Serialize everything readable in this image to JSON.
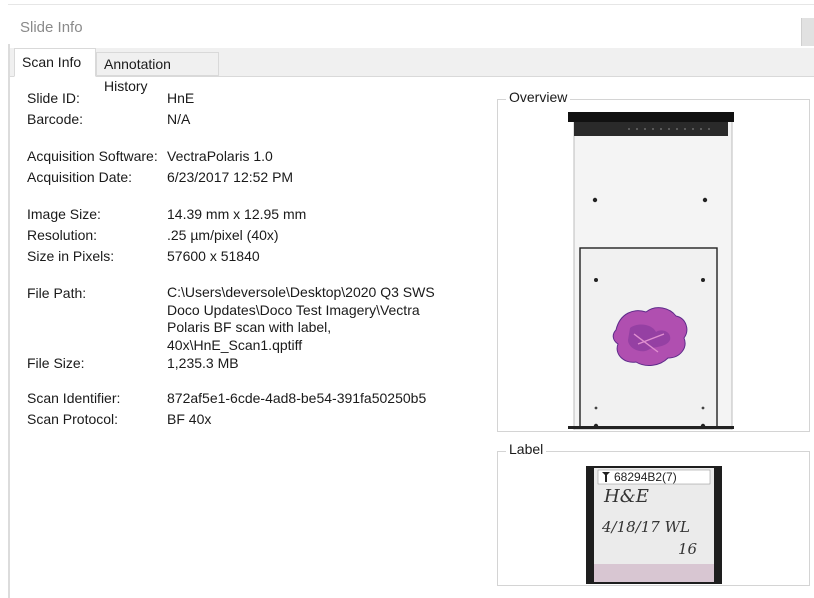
{
  "window": {
    "title": "Slide Info"
  },
  "tabs": [
    {
      "label": "Scan Info",
      "active": true
    },
    {
      "label": "Annotation History",
      "active": false
    }
  ],
  "scan_info": {
    "slide_id": {
      "key": "Slide ID:",
      "value": "HnE"
    },
    "barcode": {
      "key": "Barcode:",
      "value": "N/A"
    },
    "acq_software": {
      "key": "Acquisition Software:",
      "value": "VectraPolaris 1.0"
    },
    "acq_date": {
      "key": "Acquisition Date:",
      "value": "6/23/2017 12:52 PM"
    },
    "image_size": {
      "key": "Image Size:",
      "value": "14.39 mm x 12.95 mm"
    },
    "resolution": {
      "key": "Resolution:",
      "value": ".25 µm/pixel (40x)"
    },
    "size_pixels": {
      "key": "Size in Pixels:",
      "value": "57600 x 51840"
    },
    "file_path": {
      "key": "File Path:",
      "value": "C:\\Users\\deversole\\Desktop\\2020 Q3 SWS\nDoco Updates\\Doco Test Imagery\\Vectra\nPolaris BF scan with label,\n40x\\HnE_Scan1.qptiff"
    },
    "file_size": {
      "key": "File Size:",
      "value": "1,235.3 MB"
    },
    "scan_identifier": {
      "key": "Scan Identifier:",
      "value": "872af5e1-6cde-4ad8-be54-391fa50250b5"
    },
    "scan_protocol": {
      "key": "Scan Protocol:",
      "value": "BF 40x"
    }
  },
  "overview": {
    "label": "Overview"
  },
  "label_panel": {
    "label": "Label",
    "barcode_text": "68294B2(7)",
    "handwriting_line1": "H&E",
    "handwriting_line2": "4/18/17 WL",
    "handwriting_line3": "16"
  },
  "colors": {
    "tissue_primary": "#b04fb0",
    "tissue_dark": "#5e2a8a",
    "tab_strip": "#f0f0f0"
  }
}
